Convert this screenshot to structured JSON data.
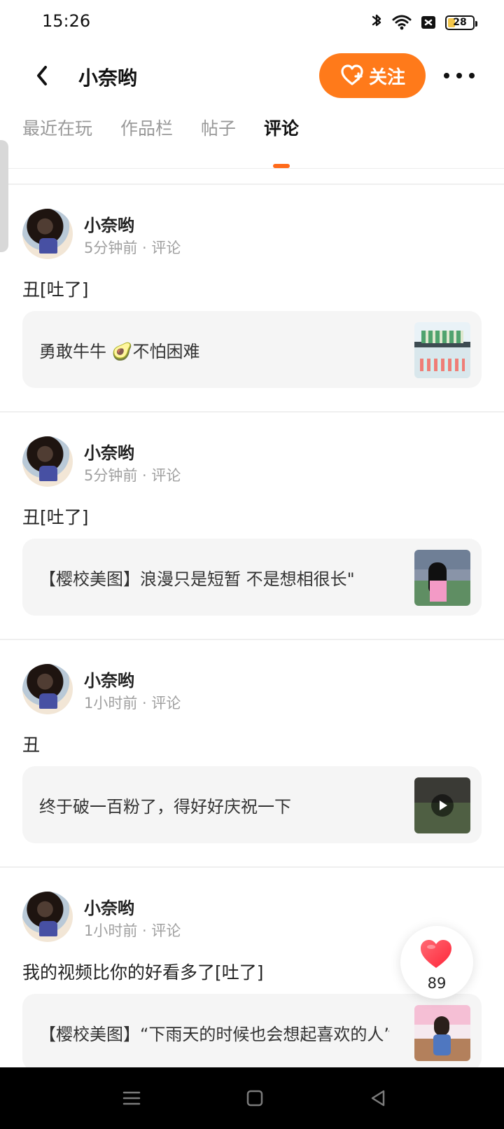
{
  "status": {
    "time": "15:26",
    "battery": "28"
  },
  "header": {
    "title": "小奈哟",
    "follow_label": "关注"
  },
  "tabs": [
    {
      "label": "最近在玩"
    },
    {
      "label": "作品栏"
    },
    {
      "label": "帖子"
    },
    {
      "label": "评论",
      "active": true
    }
  ],
  "posts": [
    {
      "username": "小奈哟",
      "meta": "5分钟前 · 评论",
      "comment": "丑[吐了]",
      "quote": "勇敢牛牛 🥑不怕困难",
      "thumb": "thumb-a"
    },
    {
      "username": "小奈哟",
      "meta": "5分钟前 · 评论",
      "comment": "丑[吐了]",
      "quote": "【樱校美图】浪漫只是短暂  不是想相很长\"",
      "thumb": "thumb-b"
    },
    {
      "username": "小奈哟",
      "meta": "1小时前 · 评论",
      "comment": "丑",
      "quote": "终于破一百粉了，得好好庆祝一下",
      "thumb": "thumb-c"
    },
    {
      "username": "小奈哟",
      "meta": "1小时前 · 评论",
      "comment": "我的视频比你的好看多了[吐了]",
      "quote": "【樱校美图】“下雨天的时候也会想起喜欢的人”",
      "thumb": "thumb-d"
    }
  ],
  "like": {
    "count": "89"
  }
}
